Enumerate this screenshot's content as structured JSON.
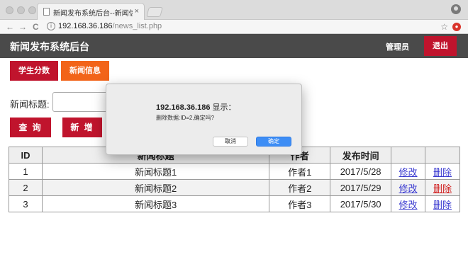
{
  "browser": {
    "tab_title": "新闻发布系统后台--新闻信息·",
    "tab_close": "×",
    "url_host": "192.168.36.186",
    "url_path": "/news_list.php",
    "back_icon": "←",
    "forward_icon": "→",
    "reload_icon": "C",
    "info_icon": "i",
    "star_icon": "☆"
  },
  "header": {
    "title": "新闻发布系统后台",
    "user_label": "管理员",
    "logout_label": "退出"
  },
  "nav": {
    "items": [
      {
        "label": "学生分数",
        "color": "#c0142d"
      },
      {
        "label": "新闻信息",
        "color": "#f26419"
      }
    ]
  },
  "search": {
    "label": "新闻标题:",
    "value": "",
    "query_label": "查 询",
    "add_label": "新 增"
  },
  "table": {
    "headers": [
      "ID",
      "新闻标题",
      "作者",
      "发布时间",
      "",
      ""
    ],
    "rows": [
      {
        "id": "1",
        "title": "新闻标题1",
        "author": "作者1",
        "date": "2017/5/28",
        "edit": "修改",
        "delete": "删除"
      },
      {
        "id": "2",
        "title": "新闻标题2",
        "author": "作者2",
        "date": "2017/5/29",
        "edit": "修改",
        "delete": "删除"
      },
      {
        "id": "3",
        "title": "新闻标题3",
        "author": "作者3",
        "date": "2017/5/30",
        "edit": "修改",
        "delete": "删除"
      }
    ]
  },
  "dialog": {
    "host": "192.168.36.186",
    "suffix": " 显示：",
    "message": "删除数据:ID=2,确定吗?",
    "cancel_label": "取消",
    "ok_label": "确定"
  },
  "colors": {
    "header_bg": "#4a4a4a",
    "accent_red": "#c0142d",
    "accent_orange": "#f26419",
    "link_blue": "#3a3ad0",
    "ok_blue": "#3d8df5"
  }
}
